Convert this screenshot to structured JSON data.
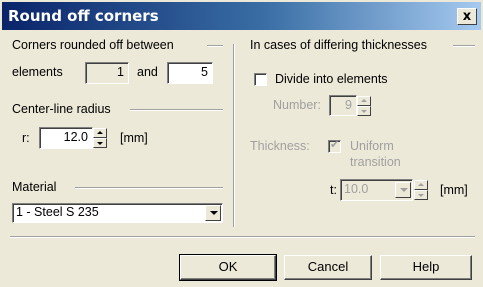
{
  "title": "Round off corners",
  "close_label": "x",
  "corners": {
    "group_label": "Corners rounded off between",
    "elements_label": "elements",
    "from_value": "1",
    "and_label": "and",
    "to_value": "5"
  },
  "radius": {
    "group_label": "Center-line radius",
    "r_label": "r:",
    "value": "12.0",
    "unit": "[mm]"
  },
  "material": {
    "group_label": "Material",
    "selected": "1 - Steel S 235"
  },
  "thickness_group": {
    "group_label": "In cases of differing thicknesses",
    "divide_label": "Divide into elements",
    "divide_checked": false,
    "number_label": "Number:",
    "number_value": "9",
    "thickness_label": "Thickness:",
    "uniform_label_1": "Uniform",
    "uniform_label_2": "transition",
    "uniform_checked": true,
    "t_label": "t:",
    "t_value": "10.0",
    "t_unit": "[mm]"
  },
  "buttons": {
    "ok": "OK",
    "cancel": "Cancel",
    "help": "Help"
  }
}
